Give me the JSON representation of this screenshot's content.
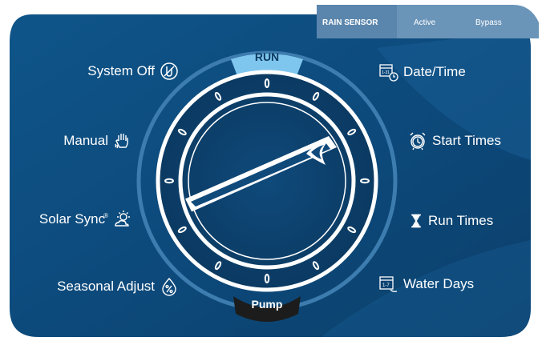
{
  "rain_sensor": {
    "title": "RAIN SENSOR",
    "option_active": "Active",
    "option_bypass": "Bypass"
  },
  "dial": {
    "top_label": "RUN",
    "bottom_label": "Pump"
  },
  "left_positions": [
    {
      "label": "System Off",
      "icon": "system-off-icon"
    },
    {
      "label": "Manual",
      "icon": "hand-icon"
    },
    {
      "label": "Solar Sync",
      "icon": "sun-cloud-icon",
      "mark": "®"
    },
    {
      "label": "Seasonal Adjust",
      "icon": "percent-drop-icon"
    }
  ],
  "right_positions": [
    {
      "label": "Date/Time",
      "icon": "calendar-clock-icon",
      "icon_text": "1-31"
    },
    {
      "label": "Start Times",
      "icon": "alarm-clock-icon"
    },
    {
      "label": "Run Times",
      "icon": "hourglass-icon"
    },
    {
      "label": "Water Days",
      "icon": "calendar-week-icon",
      "icon_text": "1-7"
    }
  ],
  "colors": {
    "panel": "#0d4d80",
    "panel_dark": "#0a3d66",
    "run_highlight": "#7fc6ee",
    "pump_highlight": "#1a1a1a",
    "tab": "#6a94b8"
  }
}
